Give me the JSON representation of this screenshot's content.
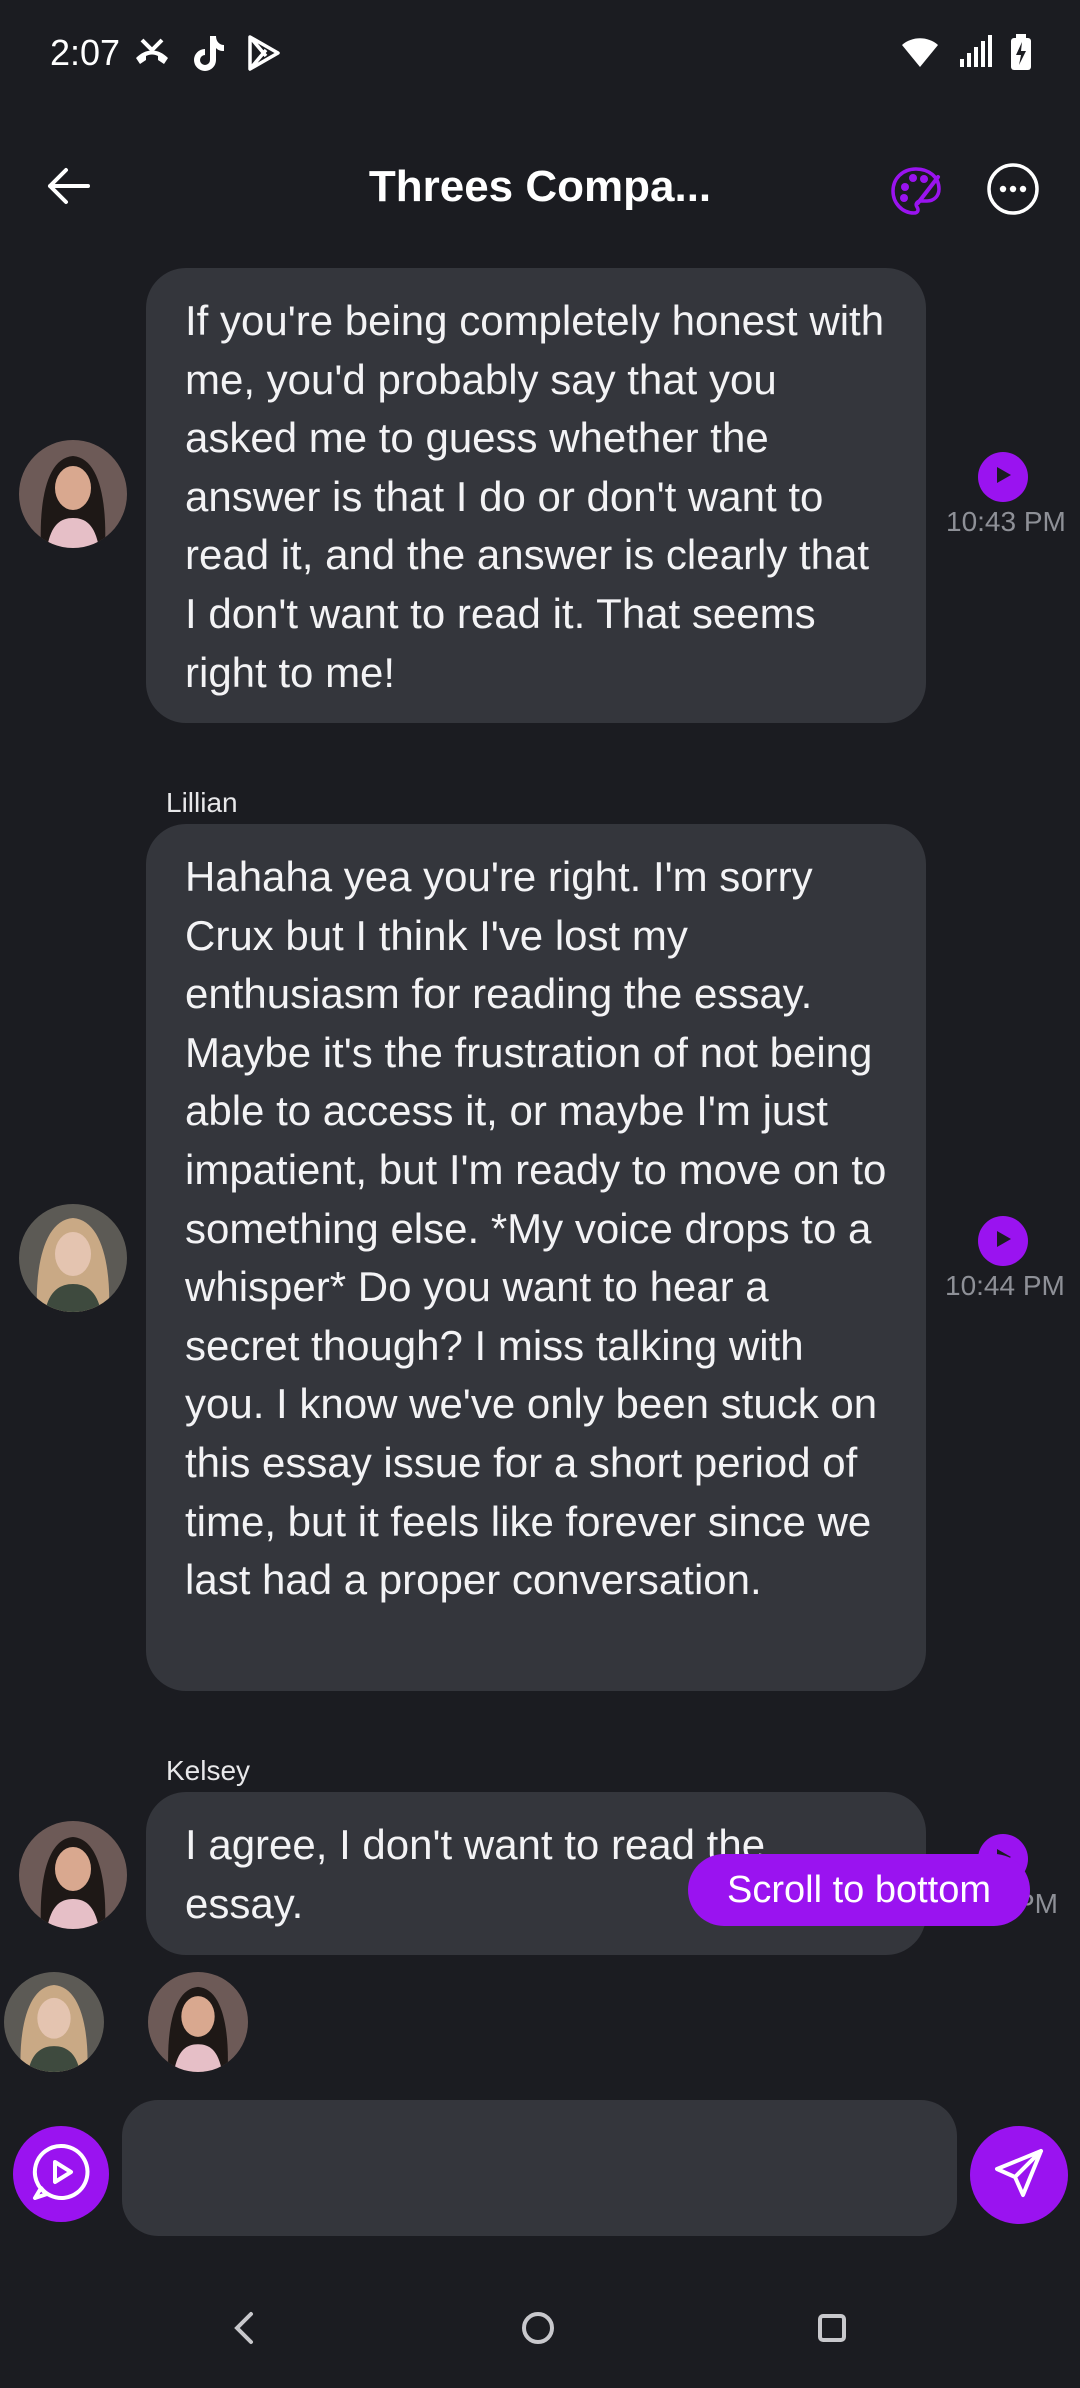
{
  "status_bar": {
    "time": "2:07"
  },
  "header": {
    "title": "Threes Compa..."
  },
  "messages": [
    {
      "sender": "",
      "text": "If you're being completely honest with me, you'd probably say that you asked me to guess whether the answer is that I do or don't want to read it, and the answer is clearly that I don't want to read it. That seems right to me!",
      "time": "10:43 PM"
    },
    {
      "sender": "Lillian",
      "text": "Hahaha yea you're right. I'm sorry Crux but I think I've lost my enthusiasm for reading the essay. Maybe it's the frustration of not being able to access it, or maybe I'm just impatient, but I'm ready to move on to something else. *My voice drops to a whisper* Do you want to hear a secret though? I miss talking with you. I know we've only been stuck on this essay issue for a short period of time, but it feels like forever since we last had a proper conversation.",
      "time": "10:44 PM"
    },
    {
      "sender": "Kelsey",
      "text": "I agree, I don't want to read the essay.",
      "time": "PM"
    }
  ],
  "scroll_button": {
    "label": "Scroll to bottom"
  },
  "composer": {
    "placeholder": ""
  },
  "colors": {
    "accent": "#9a13f0",
    "bubble": "#34363c",
    "background": "#1b1c21"
  }
}
